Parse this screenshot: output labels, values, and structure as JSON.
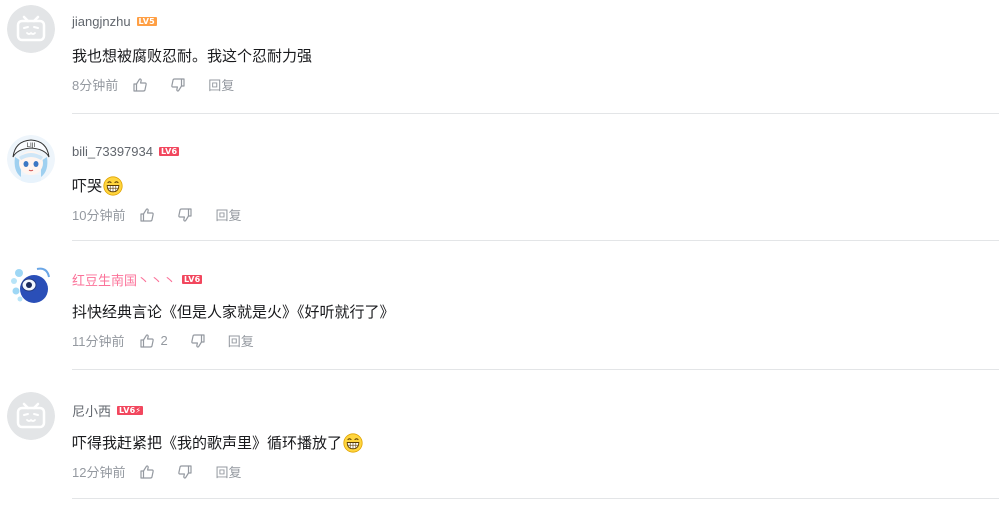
{
  "comments": [
    {
      "username": "jiangjnzhu",
      "level": "LV5",
      "content": "我也想被腐败忍耐。我这个忍耐力强",
      "emoji": false,
      "time": "8分钟前",
      "likes": "",
      "reply": "回复"
    },
    {
      "username": "bili_73397934",
      "level": "LV6",
      "content": "吓哭",
      "emoji": true,
      "time": "10分钟前",
      "likes": "",
      "reply": "回复"
    },
    {
      "username": "红豆生南国丶丶丶",
      "level": "LV6",
      "content": "抖快经典言论《但是人家就是火》《好听就行了》",
      "emoji": false,
      "time": "11分钟前",
      "likes": "2",
      "reply": "回复"
    },
    {
      "username": "尼小西",
      "level": "LV6⚡",
      "content": "吓得我赶紧把《我的歌声里》循环播放了",
      "emoji": true,
      "time": "12分钟前",
      "likes": "",
      "reply": "回复"
    }
  ],
  "icons": {
    "like": "thumb-up-icon",
    "dislike": "thumb-down-icon",
    "emoji": "grin-emoji-icon",
    "avatar_default": "bilibili-tv-avatar-icon"
  },
  "colors": {
    "vip_name": "#fb7299",
    "lv5": "#ff9f44",
    "lv6": "#f2475e",
    "meta": "#9499a0"
  }
}
